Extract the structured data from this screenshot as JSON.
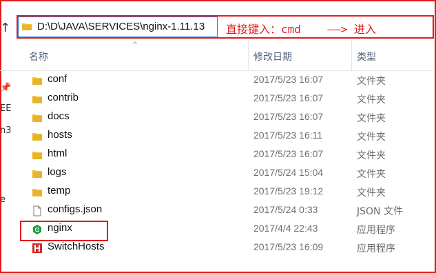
{
  "address_bar": {
    "path": "D:\\D\\JAVA\\SERVICES\\nginx-1.11.13",
    "annotation": "直接键入：cmd    ——> 进入"
  },
  "columns": {
    "name": "名称",
    "date": "修改日期",
    "type": "类型"
  },
  "left_strip": [
    "EE",
    "n3",
    "e"
  ],
  "files": [
    {
      "name": "conf",
      "date": "2017/5/23 16:07",
      "type": "文件夹",
      "icon": "folder-icon"
    },
    {
      "name": "contrib",
      "date": "2017/5/23 16:07",
      "type": "文件夹",
      "icon": "folder-icon"
    },
    {
      "name": "docs",
      "date": "2017/5/23 16:07",
      "type": "文件夹",
      "icon": "folder-icon"
    },
    {
      "name": "hosts",
      "date": "2017/5/23 16:11",
      "type": "文件夹",
      "icon": "folder-icon"
    },
    {
      "name": "html",
      "date": "2017/5/23 16:07",
      "type": "文件夹",
      "icon": "folder-icon"
    },
    {
      "name": "logs",
      "date": "2017/5/24 15:04",
      "type": "文件夹",
      "icon": "folder-icon"
    },
    {
      "name": "temp",
      "date": "2017/5/23 19:12",
      "type": "文件夹",
      "icon": "folder-icon"
    },
    {
      "name": "configs.json",
      "date": "2017/5/24 0:33",
      "type": "JSON 文件",
      "icon": "json-file-icon"
    },
    {
      "name": "nginx",
      "date": "2017/4/4 22:43",
      "type": "应用程序",
      "icon": "nginx-app-icon"
    },
    {
      "name": "SwitchHosts",
      "date": "2017/5/23 16:09",
      "type": "应用程序",
      "icon": "switchhosts-app-icon"
    }
  ],
  "colors": {
    "annotation_red": "#e21b1b",
    "folder_yellow": "#f2c33a",
    "nginx_green": "#139c3d",
    "switchhosts_red": "#d32c2c"
  }
}
